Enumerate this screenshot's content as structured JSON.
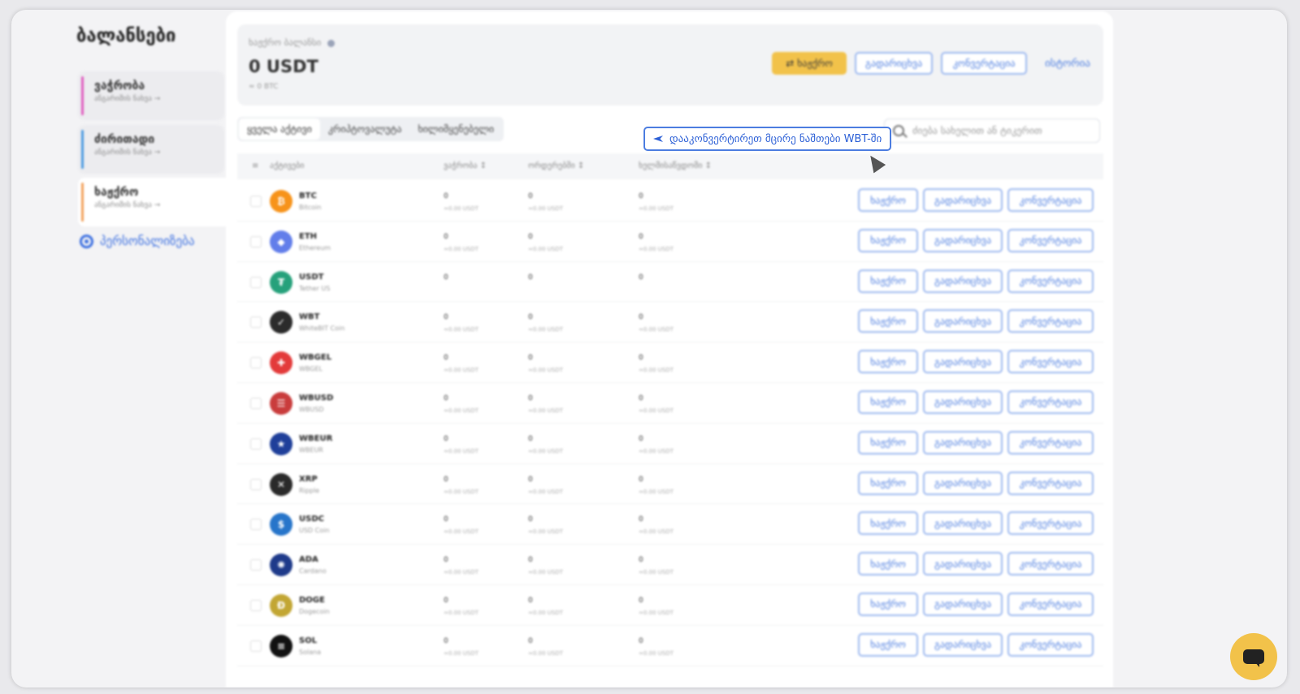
{
  "sidebar": {
    "title": "ბალანსები",
    "items": [
      {
        "label": "ვაჭრობა",
        "sub": "ანგარიშის ნახვა →",
        "color": "#e05cbf"
      },
      {
        "label": "ძირითადი",
        "sub": "ანგარიშის ნახვა →",
        "color": "#4c9be0"
      },
      {
        "label": "ხაჟქრო",
        "sub": "ანგარიშის ნახვა →",
        "color": "#f2a05a"
      }
    ],
    "settings_label": "პერსონალიზება"
  },
  "summary": {
    "label": "ხაჟქრო ბალანსი",
    "value": "0 USDT",
    "approx": "≈ 0 BTC",
    "actions": {
      "primary": "⇄ ხაჟქრო",
      "withdraw": "გადარიცხვა",
      "convert": "კონვერტაცია",
      "history": "ისტორია"
    }
  },
  "tabs": [
    "ყველა აქტივი",
    "კრიპტოვალუტა",
    "ხილიმყენებელი"
  ],
  "convert_tip": "დააკონვერტირეთ მცირე ნაშთები WBT-ში",
  "search": {
    "placeholder": "ძიება სახელით ან ტიკერით"
  },
  "table": {
    "headers": [
      "აქტივები",
      "ვაჭრობა ↕",
      "ორდერებში ↕",
      "ხელმისაწვდომი ↕"
    ],
    "row_actions": [
      "ხაჟქრო",
      "გადარიცხვა",
      "კონვერტაცია"
    ],
    "rows": [
      {
        "ticker": "BTC",
        "name": "Bitcoin",
        "v1": "0",
        "s1": "≈0.00 USDT",
        "v2": "0",
        "s2": "≈0.00 USDT",
        "v3": "0",
        "s3": "≈0.00 USDT",
        "color": "#f7931a",
        "glyph": "₿"
      },
      {
        "ticker": "ETH",
        "name": "Ethereum",
        "v1": "0",
        "s1": "≈0.00 USDT",
        "v2": "0",
        "s2": "≈0.00 USDT",
        "v3": "0",
        "s3": "≈0.00 USDT",
        "color": "#627eea",
        "glyph": "◆"
      },
      {
        "ticker": "USDT",
        "name": "Tether US",
        "v1": "0",
        "s1": "",
        "v2": "0",
        "s2": "",
        "v3": "0",
        "s3": "",
        "color": "#26a17b",
        "glyph": "₮"
      },
      {
        "ticker": "WBT",
        "name": "WhiteBIT Coin",
        "v1": "0",
        "s1": "≈0.00 USDT",
        "v2": "0",
        "s2": "≈0.00 USDT",
        "v3": "0",
        "s3": "≈0.00 USDT",
        "color": "#2b2b2b",
        "glyph": "✓"
      },
      {
        "ticker": "WBGEL",
        "name": "WBGEL",
        "v1": "0",
        "s1": "≈0.00 USDT",
        "v2": "0",
        "s2": "≈0.00 USDT",
        "v3": "0",
        "s3": "≈0.00 USDT",
        "color": "#e33a3a",
        "glyph": "✚"
      },
      {
        "ticker": "WBUSD",
        "name": "WBUSD",
        "v1": "0",
        "s1": "≈0.00 USDT",
        "v2": "0",
        "s2": "≈0.00 USDT",
        "v3": "0",
        "s3": "≈0.00 USDT",
        "color": "#c93c3c",
        "glyph": "☰"
      },
      {
        "ticker": "WBEUR",
        "name": "WBEUR",
        "v1": "0",
        "s1": "≈0.00 USDT",
        "v2": "0",
        "s2": "≈0.00 USDT",
        "v3": "0",
        "s3": "≈0.00 USDT",
        "color": "#1f3f9a",
        "glyph": "★"
      },
      {
        "ticker": "XRP",
        "name": "Ripple",
        "v1": "0",
        "s1": "≈0.00 USDT",
        "v2": "0",
        "s2": "≈0.00 USDT",
        "v3": "0",
        "s3": "≈0.00 USDT",
        "color": "#2a2a2a",
        "glyph": "✕"
      },
      {
        "ticker": "USDC",
        "name": "USD Coin",
        "v1": "0",
        "s1": "≈0.00 USDT",
        "v2": "0",
        "s2": "≈0.00 USDT",
        "v3": "0",
        "s3": "≈0.00 USDT",
        "color": "#2775ca",
        "glyph": "$"
      },
      {
        "ticker": "ADA",
        "name": "Cardano",
        "v1": "0",
        "s1": "≈0.00 USDT",
        "v2": "0",
        "s2": "≈0.00 USDT",
        "v3": "0",
        "s3": "≈0.00 USDT",
        "color": "#1e3a8a",
        "glyph": "✺"
      },
      {
        "ticker": "DOGE",
        "name": "Dogecoin",
        "v1": "0",
        "s1": "≈0.00 USDT",
        "v2": "0",
        "s2": "≈0.00 USDT",
        "v3": "0",
        "s3": "≈0.00 USDT",
        "color": "#c2a633",
        "glyph": "Ð"
      },
      {
        "ticker": "SOL",
        "name": "Solana",
        "v1": "0",
        "s1": "≈0.00 USDT",
        "v2": "0",
        "s2": "≈0.00 USDT",
        "v3": "0",
        "s3": "≈0.00 USDT",
        "color": "#111111",
        "glyph": "≡"
      }
    ]
  },
  "icons": {
    "gear": "gear-icon",
    "search": "search-icon",
    "chat": "chat-icon",
    "convert": "convert-icon"
  }
}
